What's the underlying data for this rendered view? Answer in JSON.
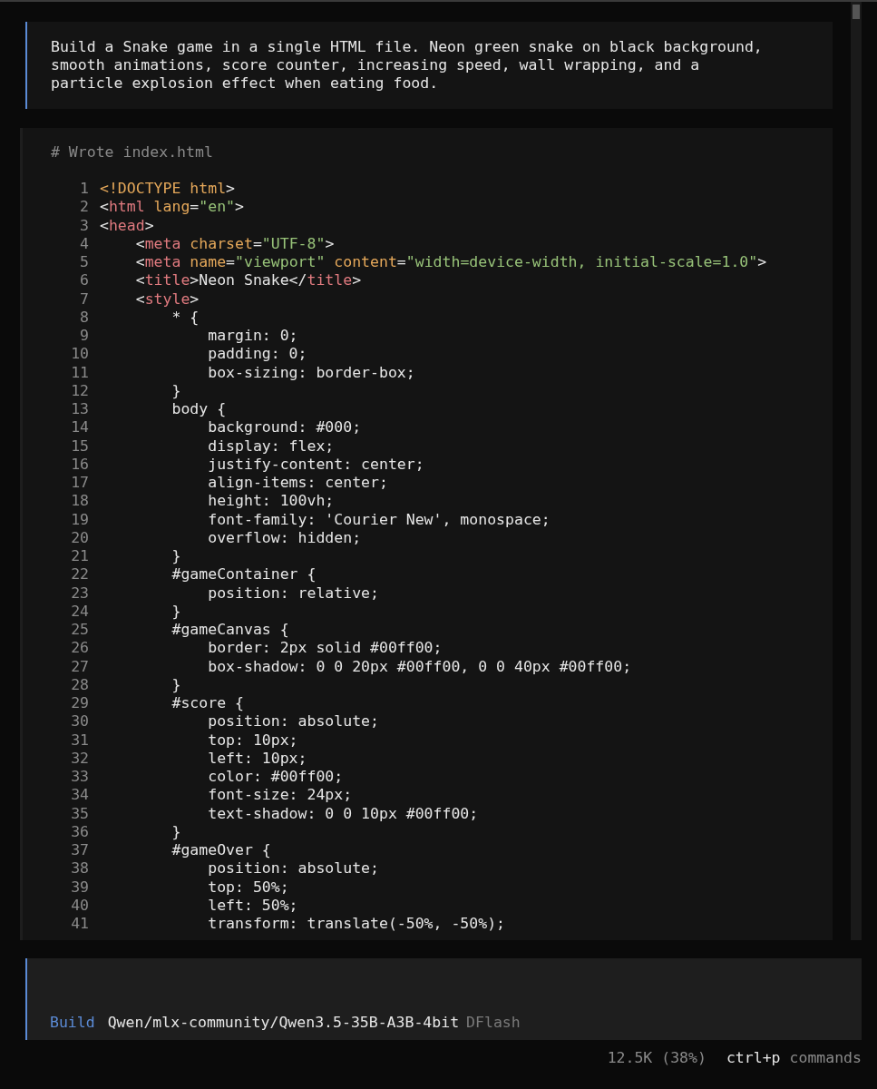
{
  "prompt": {
    "text": "Build a Snake game in a single HTML file. Neon green snake on black background, smooth animations, score counter, increasing speed, wall wrapping, and a particle explosion effect when eating food."
  },
  "tool_output": {
    "title": "# Wrote index.html",
    "lines": [
      {
        "number": "1",
        "tokens": [
          {
            "kind": "attr",
            "text": "<!DOCTYPE html"
          },
          {
            "kind": "punct",
            "text": ">"
          }
        ]
      },
      {
        "number": "2",
        "tokens": [
          {
            "kind": "punct",
            "text": "<"
          },
          {
            "kind": "tag",
            "text": "html"
          },
          {
            "kind": "attr",
            "text": " lang"
          },
          {
            "kind": "punct",
            "text": "="
          },
          {
            "kind": "string",
            "text": "\"en\""
          },
          {
            "kind": "punct",
            "text": ">"
          }
        ]
      },
      {
        "number": "3",
        "tokens": [
          {
            "kind": "punct",
            "text": "<"
          },
          {
            "kind": "tag",
            "text": "head"
          },
          {
            "kind": "punct",
            "text": ">"
          }
        ]
      },
      {
        "number": "4",
        "tokens": [
          {
            "kind": "punct",
            "text": "    <"
          },
          {
            "kind": "tag",
            "text": "meta"
          },
          {
            "kind": "attr",
            "text": " charset"
          },
          {
            "kind": "punct",
            "text": "="
          },
          {
            "kind": "string",
            "text": "\"UTF-8\""
          },
          {
            "kind": "punct",
            "text": ">"
          }
        ]
      },
      {
        "number": "5",
        "tokens": [
          {
            "kind": "punct",
            "text": "    <"
          },
          {
            "kind": "tag",
            "text": "meta"
          },
          {
            "kind": "attr",
            "text": " name"
          },
          {
            "kind": "punct",
            "text": "="
          },
          {
            "kind": "string",
            "text": "\"viewport\""
          },
          {
            "kind": "attr",
            "text": " content"
          },
          {
            "kind": "punct",
            "text": "="
          },
          {
            "kind": "string",
            "text": "\"width=device-width, initial-scale=1.0\""
          },
          {
            "kind": "punct",
            "text": ">"
          }
        ]
      },
      {
        "number": "6",
        "tokens": [
          {
            "kind": "punct",
            "text": "    <"
          },
          {
            "kind": "tag",
            "text": "title"
          },
          {
            "kind": "punct",
            "text": ">Neon Snake</"
          },
          {
            "kind": "tag",
            "text": "title"
          },
          {
            "kind": "punct",
            "text": ">"
          }
        ]
      },
      {
        "number": "7",
        "tokens": [
          {
            "kind": "punct",
            "text": "    <"
          },
          {
            "kind": "tag",
            "text": "style"
          },
          {
            "kind": "punct",
            "text": ">"
          }
        ]
      },
      {
        "number": "8",
        "tokens": [
          {
            "kind": "punct",
            "text": "        * {"
          }
        ]
      },
      {
        "number": "9",
        "tokens": [
          {
            "kind": "punct",
            "text": "            margin: 0;"
          }
        ]
      },
      {
        "number": "10",
        "tokens": [
          {
            "kind": "punct",
            "text": "            padding: 0;"
          }
        ]
      },
      {
        "number": "11",
        "tokens": [
          {
            "kind": "punct",
            "text": "            box-sizing: border-box;"
          }
        ]
      },
      {
        "number": "12",
        "tokens": [
          {
            "kind": "punct",
            "text": "        }"
          }
        ]
      },
      {
        "number": "13",
        "tokens": [
          {
            "kind": "punct",
            "text": "        body {"
          }
        ]
      },
      {
        "number": "14",
        "tokens": [
          {
            "kind": "punct",
            "text": "            background: #000;"
          }
        ]
      },
      {
        "number": "15",
        "tokens": [
          {
            "kind": "punct",
            "text": "            display: flex;"
          }
        ]
      },
      {
        "number": "16",
        "tokens": [
          {
            "kind": "punct",
            "text": "            justify-content: center;"
          }
        ]
      },
      {
        "number": "17",
        "tokens": [
          {
            "kind": "punct",
            "text": "            align-items: center;"
          }
        ]
      },
      {
        "number": "18",
        "tokens": [
          {
            "kind": "punct",
            "text": "            height: 100vh;"
          }
        ]
      },
      {
        "number": "19",
        "tokens": [
          {
            "kind": "punct",
            "text": "            font-family: 'Courier New', monospace;"
          }
        ]
      },
      {
        "number": "20",
        "tokens": [
          {
            "kind": "punct",
            "text": "            overflow: hidden;"
          }
        ]
      },
      {
        "number": "21",
        "tokens": [
          {
            "kind": "punct",
            "text": "        }"
          }
        ]
      },
      {
        "number": "22",
        "tokens": [
          {
            "kind": "punct",
            "text": "        #gameContainer {"
          }
        ]
      },
      {
        "number": "23",
        "tokens": [
          {
            "kind": "punct",
            "text": "            position: relative;"
          }
        ]
      },
      {
        "number": "24",
        "tokens": [
          {
            "kind": "punct",
            "text": "        }"
          }
        ]
      },
      {
        "number": "25",
        "tokens": [
          {
            "kind": "punct",
            "text": "        #gameCanvas {"
          }
        ]
      },
      {
        "number": "26",
        "tokens": [
          {
            "kind": "punct",
            "text": "            border: 2px solid #00ff00;"
          }
        ]
      },
      {
        "number": "27",
        "tokens": [
          {
            "kind": "punct",
            "text": "            box-shadow: 0 0 20px #00ff00, 0 0 40px #00ff00;"
          }
        ]
      },
      {
        "number": "28",
        "tokens": [
          {
            "kind": "punct",
            "text": "        }"
          }
        ]
      },
      {
        "number": "29",
        "tokens": [
          {
            "kind": "punct",
            "text": "        #score {"
          }
        ]
      },
      {
        "number": "30",
        "tokens": [
          {
            "kind": "punct",
            "text": "            position: absolute;"
          }
        ]
      },
      {
        "number": "31",
        "tokens": [
          {
            "kind": "punct",
            "text": "            top: 10px;"
          }
        ]
      },
      {
        "number": "32",
        "tokens": [
          {
            "kind": "punct",
            "text": "            left: 10px;"
          }
        ]
      },
      {
        "number": "33",
        "tokens": [
          {
            "kind": "punct",
            "text": "            color: #00ff00;"
          }
        ]
      },
      {
        "number": "34",
        "tokens": [
          {
            "kind": "punct",
            "text": "            font-size: 24px;"
          }
        ]
      },
      {
        "number": "35",
        "tokens": [
          {
            "kind": "punct",
            "text": "            text-shadow: 0 0 10px #00ff00;"
          }
        ]
      },
      {
        "number": "36",
        "tokens": [
          {
            "kind": "punct",
            "text": "        }"
          }
        ]
      },
      {
        "number": "37",
        "tokens": [
          {
            "kind": "punct",
            "text": "        #gameOver {"
          }
        ]
      },
      {
        "number": "38",
        "tokens": [
          {
            "kind": "punct",
            "text": "            position: absolute;"
          }
        ]
      },
      {
        "number": "39",
        "tokens": [
          {
            "kind": "punct",
            "text": "            top: 50%;"
          }
        ]
      },
      {
        "number": "40",
        "tokens": [
          {
            "kind": "punct",
            "text": "            left: 50%;"
          }
        ]
      },
      {
        "number": "41",
        "tokens": [
          {
            "kind": "punct",
            "text": "            transform: translate(-50%, -50%);"
          }
        ]
      }
    ]
  },
  "input": {
    "mode": "Build",
    "model": "Qwen/mlx-community/Qwen3.5-35B-A3B-4bit",
    "variant": "DFlash"
  },
  "status_bar": {
    "context": "12.5K (38%)",
    "shortcut": "ctrl+p",
    "shortcut_label": "commands"
  }
}
